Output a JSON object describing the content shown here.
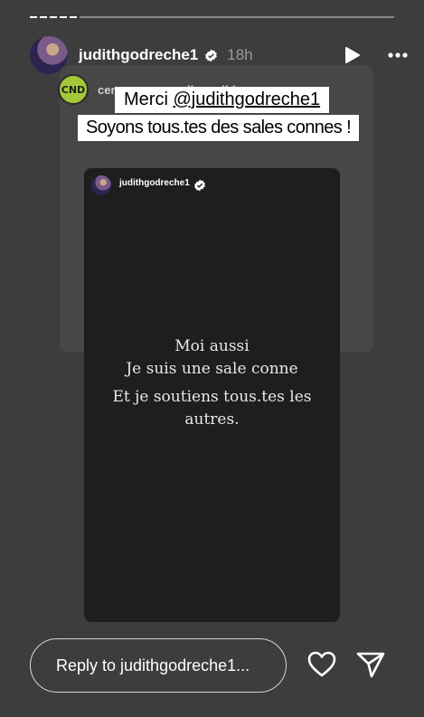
{
  "header": {
    "username": "judithgodreche1",
    "time": "18h"
  },
  "shared_post": {
    "account": "cerveaux_non_disponibles",
    "logo_text": "CND",
    "caption_line1_prefix": "Merci ",
    "caption_line1_mention": "@judithgodreche1",
    "caption_line2": "Soyons tous.tes des sales connes !"
  },
  "inner_post": {
    "username": "judithgodreche1",
    "lines": [
      "Moi aussi",
      "Je suis une sale conne",
      "Et je soutiens tous.tes les",
      "autres."
    ]
  },
  "reply": {
    "placeholder": "Reply to judithgodreche1..."
  },
  "colors": {
    "background": "#3d3d3d",
    "cnd_logo": "#a3c93a",
    "verified_badge": "#ffffff"
  },
  "icons": [
    "verified-icon",
    "play-icon",
    "more-icon",
    "heart-icon",
    "send-icon"
  ]
}
